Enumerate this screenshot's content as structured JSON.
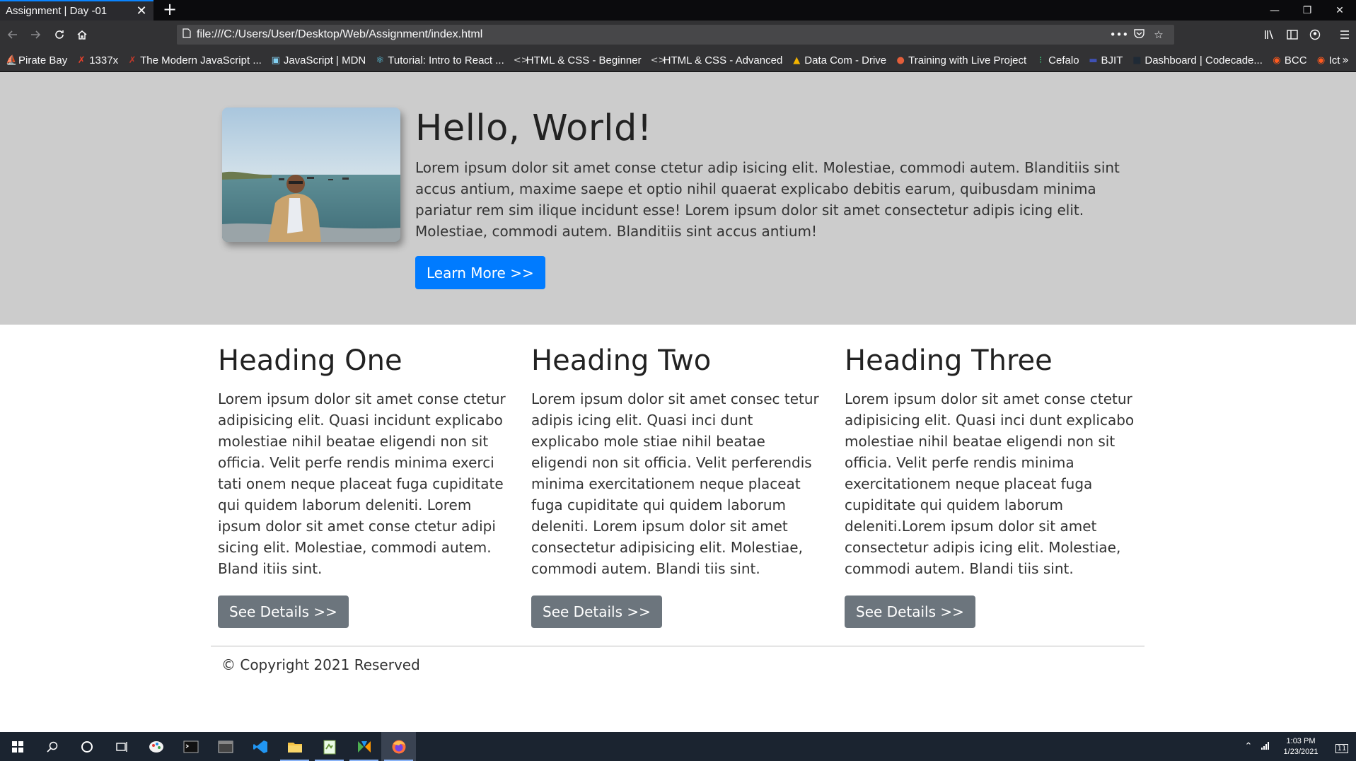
{
  "browser": {
    "tab_title": "Assignment | Day -01",
    "tab_close": "✕",
    "new_tab": "+",
    "url": "file:///C:/Users/User/Desktop/Web/Assignment/index.html",
    "window_controls": {
      "minimize": "—",
      "restore": "❐",
      "close": "✕"
    },
    "bookmarks": [
      {
        "label": "Pirate Bay",
        "icon": "pirate-ship-icon",
        "color": "#f9f9fa"
      },
      {
        "label": "1337x",
        "icon": "x-logo-icon",
        "color": "#e8412c"
      },
      {
        "label": "The Modern JavaScript ...",
        "icon": "javascript-info-icon",
        "color": "#c0392b"
      },
      {
        "label": "JavaScript | MDN",
        "icon": "mdn-icon",
        "color": "#83d0f2"
      },
      {
        "label": "Tutorial: Intro to React ...",
        "icon": "react-icon",
        "color": "#61dafb"
      },
      {
        "label": "HTML & CSS - Beginner",
        "icon": "code-icon",
        "color": "#cfcfcf"
      },
      {
        "label": "HTML & CSS - Advanced",
        "icon": "code-icon",
        "color": "#cfcfcf"
      },
      {
        "label": "Data Com - Drive",
        "icon": "google-drive-icon",
        "color": "#f4b400"
      },
      {
        "label": "Training with Live Project",
        "icon": "training-icon",
        "color": "#e45e3a"
      },
      {
        "label": "Cefalo",
        "icon": "cefalo-icon",
        "color": "#3ddc84"
      },
      {
        "label": "BJIT",
        "icon": "bjit-icon",
        "color": "#3f51b5"
      },
      {
        "label": "Dashboard | Codecade...",
        "icon": "codecademy-icon",
        "color": "#1f2a36"
      },
      {
        "label": "BCC",
        "icon": "bcc-icon",
        "color": "#ff5a1f"
      },
      {
        "label": "Ict",
        "icon": "ict-icon",
        "color": "#ff5a1f"
      }
    ]
  },
  "hero": {
    "title": "Hello, World!",
    "text": "Lorem ipsum dolor sit amet conse ctetur adip isicing elit. Molestiae, commodi autem. Blanditiis sint accus antium, maxime saepe et optio nihil quaerat explicabo debitis earum, quibusdam minima pariatur rem sim ilique incidunt esse! Lorem ipsum dolor sit amet consectetur adipis icing elit. Molestiae, commodi autem. Blanditiis sint accus antium!",
    "button": "Learn More >>"
  },
  "columns": [
    {
      "title": "Heading One",
      "text": "Lorem ipsum dolor sit amet conse ctetur adipisicing elit. Quasi incidunt explicabo molestiae nihil beatae eligendi non sit officia. Velit perfe rendis minima exerci tati onem neque placeat fuga cupiditate qui quidem laborum deleniti. Lorem ipsum dolor sit amet conse ctetur adipi sicing elit. Molestiae, commodi autem. Bland itiis sint.",
      "button": "See Details >>"
    },
    {
      "title": "Heading Two",
      "text": "Lorem ipsum dolor sit amet consec tetur adipis icing elit. Quasi inci dunt explicabo mole stiae nihil beatae eligendi non sit officia. Velit perferendis minima exercitationem neque placeat fuga cupiditate qui quidem laborum deleniti. Lorem ipsum dolor sit amet consectetur adipisicing elit. Molestiae, commodi autem. Blandi tiis sint.",
      "button": "See Details >>"
    },
    {
      "title": "Heading Three",
      "text": "Lorem ipsum dolor sit amet conse ctetur adipisicing elit. Quasi inci dunt explicabo molestiae nihil beatae eligendi non sit officia. Velit perfe rendis minima exercitationem neque placeat fuga cupiditate qui quidem laborum deleniti.Lorem ipsum dolor sit amet consectetur adipis icing elit. Molestiae, commodi autem. Blandi tiis sint.",
      "button": "See Details >>"
    }
  ],
  "footer": {
    "text": "© Copyright 2021 Reserved"
  },
  "taskbar": {
    "time": "1:03 PM",
    "date": "1/23/2021",
    "notifications": "11"
  },
  "colors": {
    "primary": "#007bff",
    "secondary": "#6c757d",
    "jumbotron_bg": "#cccccc"
  }
}
